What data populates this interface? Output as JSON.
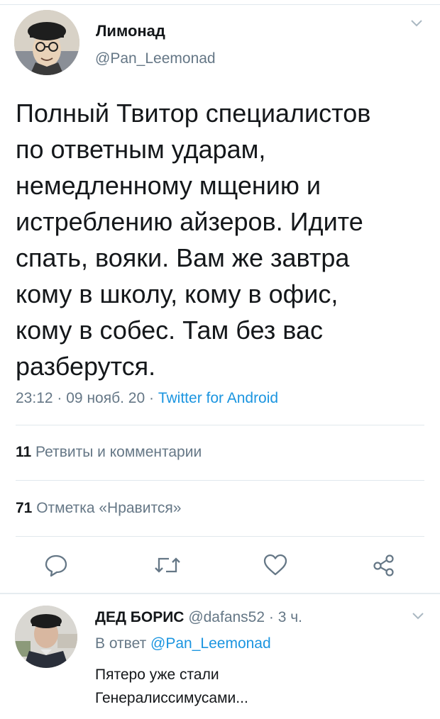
{
  "tweet": {
    "display_name": "Лимонад",
    "handle": "@Pan_Leemonad",
    "text_lines": [
      "Полный Твитор специалистов",
      "по ответным ударам,",
      "немедленному мщению и",
      "истреблению айзеров. Идите",
      "спать, вояки. Вам же завтра",
      "кому в школу, кому в офис,",
      "кому в собес. Там без вас",
      "разберутся."
    ],
    "time": "23:12",
    "date": "09 нояб. 20",
    "source": "Twitter for Android",
    "meta_sep": "·",
    "retweets_count": "11",
    "retweets_label": "Ретвиты и комментарии",
    "likes_count": "71",
    "likes_label": "Отметка «Нравится»"
  },
  "actions": {
    "reply_icon": "comment-icon",
    "retweet_icon": "retweet-icon",
    "like_icon": "heart-icon",
    "share_icon": "share-icon"
  },
  "reply": {
    "display_name": "ДЕД БОРИС",
    "handle_time": "@dafans52 · 3 ч.",
    "in_reply_prefix": "В ответ",
    "in_reply_handle": "@Pan_Leemonad",
    "text_lines": [
      "Пятеро уже стали",
      "Генералиссимусами..."
    ]
  },
  "colors": {
    "link": "#1b95e0",
    "muted": "#657786",
    "text": "#14171a",
    "divider": "#e1e8ed"
  }
}
